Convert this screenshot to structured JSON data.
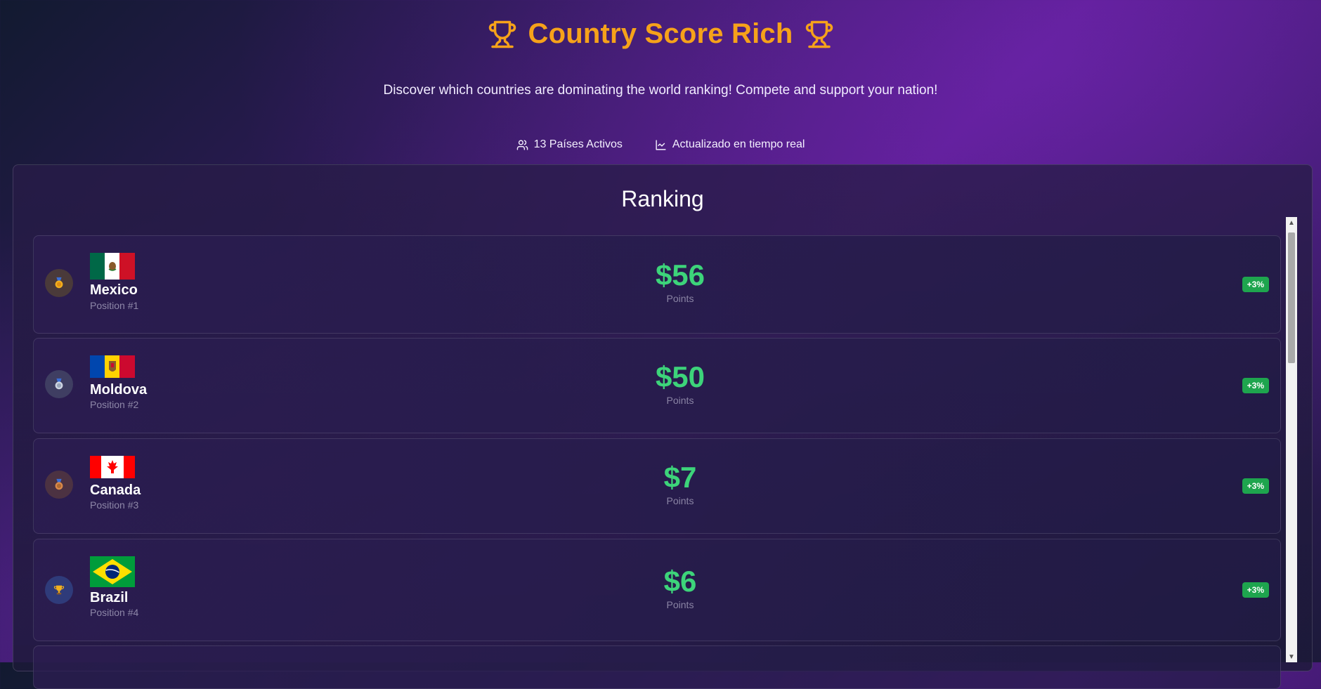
{
  "header": {
    "title": "Country Score Rich",
    "subtitle": "Discover which countries are dominating the world ranking! Compete and support your nation!",
    "stats": [
      {
        "icon": "users-icon",
        "label": "13 Países Activos"
      },
      {
        "icon": "trend-chart-icon",
        "label": "Actualizado en tiempo real"
      }
    ]
  },
  "ranking": {
    "title": "Ranking",
    "entries": [
      {
        "country": "Mexico",
        "position": "Position #1",
        "score": "$56",
        "score_label": "Points",
        "change": "+3%",
        "medal": "gold-medal-icon",
        "flag": "mexico-flag-icon"
      },
      {
        "country": "Moldova",
        "position": "Position #2",
        "score": "$50",
        "score_label": "Points",
        "change": "+3%",
        "medal": "silver-medal-icon",
        "flag": "moldova-flag-icon"
      },
      {
        "country": "Canada",
        "position": "Position #3",
        "score": "$7",
        "score_label": "Points",
        "change": "+3%",
        "medal": "bronze-medal-icon",
        "flag": "canada-flag-icon"
      },
      {
        "country": "Brazil",
        "position": "Position #4",
        "score": "$6",
        "score_label": "Points",
        "change": "+3%",
        "medal": "trophy-icon",
        "flag": "brazil-flag-icon"
      }
    ]
  },
  "colors": {
    "title": "#f6a21a",
    "score": "#3dd47a",
    "badge": "#1ea54e"
  }
}
